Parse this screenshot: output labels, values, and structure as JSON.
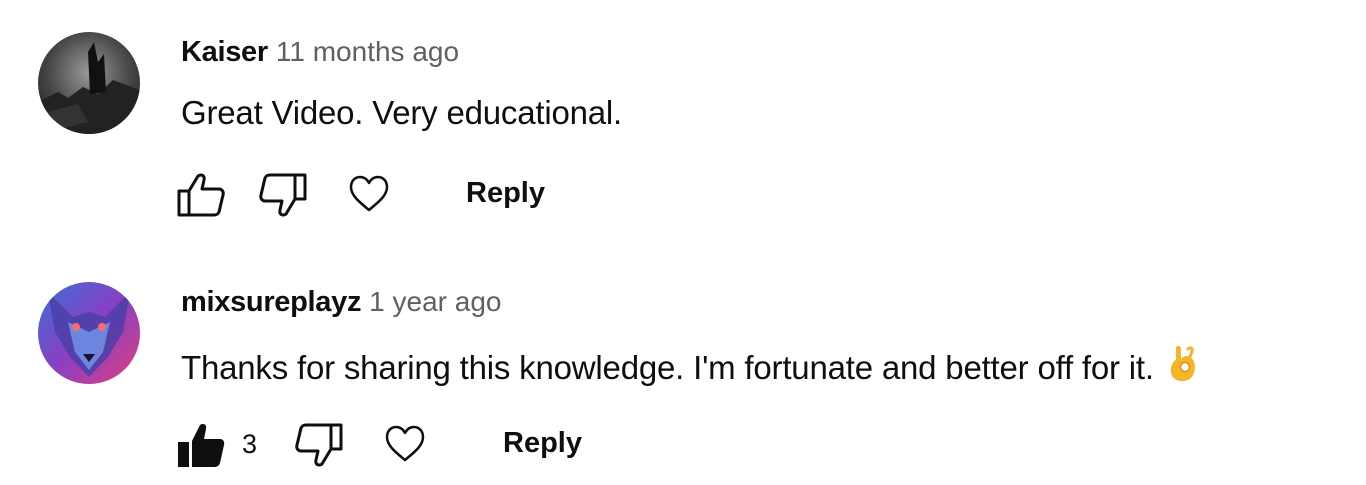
{
  "comments": [
    {
      "author": "Kaiser",
      "time": "11 months ago",
      "text": "Great Video. Very educational.",
      "like_count": "",
      "liked": false,
      "reply_label": "Reply",
      "avatar_icon": "dark-castle-avatar"
    },
    {
      "author": "mixsureplayz",
      "time": "1 year ago",
      "text": "Thanks for sharing this knowledge. I'm fortunate and better off for it.",
      "like_count": "3",
      "liked": true,
      "reply_label": "Reply",
      "avatar_icon": "neon-wolf-avatar",
      "emoji": "ok-hand-emoji"
    }
  ],
  "icons": {
    "like": "thumbs-up-icon",
    "dislike": "thumbs-down-icon",
    "heart": "heart-icon"
  },
  "colors": {
    "text": "#0f0f0f",
    "secondary_text": "#606060",
    "emoji": "#f4b528"
  }
}
